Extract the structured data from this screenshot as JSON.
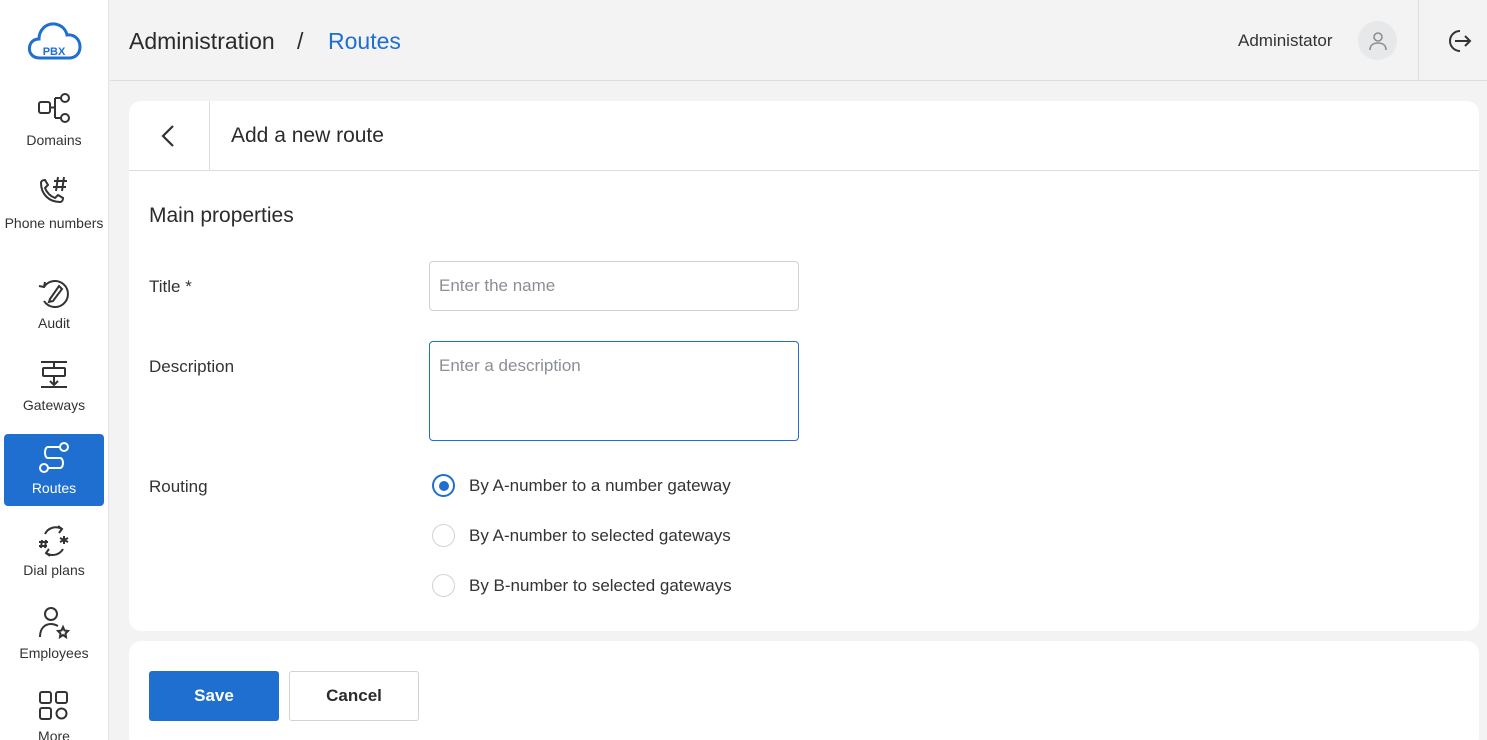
{
  "app": {
    "logo_text": "PBX",
    "brand_color": "#1f6fd1"
  },
  "sidebar": {
    "items": [
      {
        "label": "Domains",
        "icon": "domains-icon",
        "active": false
      },
      {
        "label": "Phone numbers",
        "icon": "phone-number-icon",
        "active": false
      },
      {
        "label": "Audit",
        "icon": "audit-icon",
        "active": false
      },
      {
        "label": "Gateways",
        "icon": "gateways-icon",
        "active": false
      },
      {
        "label": "Routes",
        "icon": "routes-icon",
        "active": true
      },
      {
        "label": "Dial plans",
        "icon": "dial-plans-icon",
        "active": false
      },
      {
        "label": "Employees",
        "icon": "employees-icon",
        "active": false
      },
      {
        "label": "More",
        "icon": "more-apps-icon",
        "active": false
      }
    ]
  },
  "header": {
    "breadcrumb": [
      "Administration",
      "Routes"
    ],
    "separator": "/",
    "user_name": "Administator"
  },
  "form": {
    "title": "Add a new route",
    "section_title": "Main properties",
    "title_label": "Title *",
    "title_placeholder": "Enter the name",
    "title_value": "",
    "description_label": "Description",
    "description_placeholder": "Enter a description",
    "description_value": "",
    "routing_label": "Routing",
    "routing_options": [
      {
        "label": "By A-number to a number gateway",
        "selected": true
      },
      {
        "label": "By A-number to selected gateways",
        "selected": false
      },
      {
        "label": "By B-number to selected gateways",
        "selected": false
      }
    ]
  },
  "actions": {
    "save_label": "Save",
    "cancel_label": "Cancel"
  }
}
